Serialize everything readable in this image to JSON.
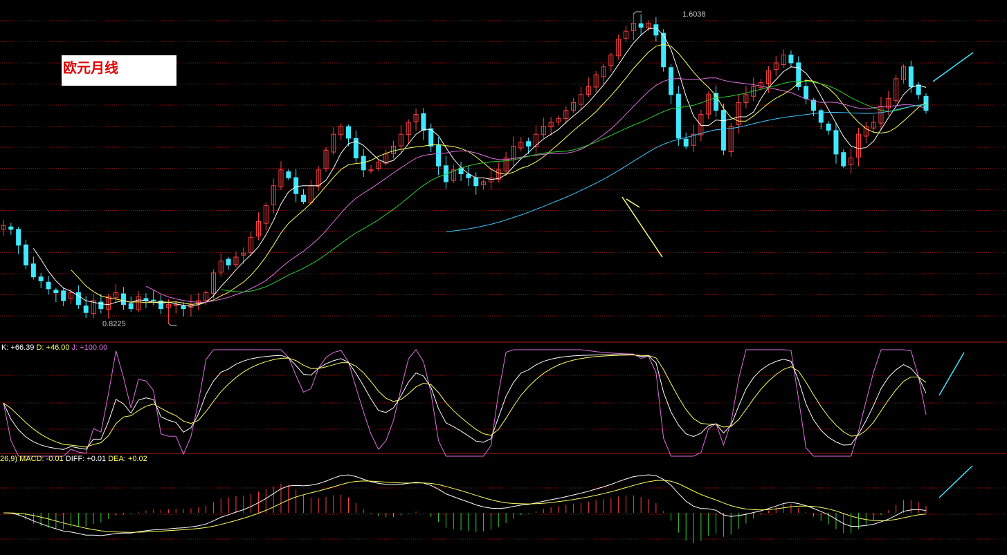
{
  "title": "欧元月线",
  "price_panel": {
    "high_label": "1.6038",
    "low_label": "0.8225"
  },
  "kdj_panel": {
    "k_label": "K: +66.39",
    "d_label": "D: +46.00",
    "j_label": "J: +100.00"
  },
  "macd_panel": {
    "params_label": "26,9)",
    "macd_label": "MACD: -0.01",
    "diff_label": "DIFF: +0.01",
    "dea_label": "DEA: +0.02"
  },
  "colors": {
    "background": "#000000",
    "grid": "#8a1a1a",
    "separator": "#b01c1c",
    "up": "#ff4040",
    "down": "#40e8ff",
    "ma5": "#ffffff",
    "ma10": "#ffff60",
    "ma20": "#e070e0",
    "ma30": "#30d030",
    "ma60": "#40c8ff",
    "k": "#ffffff",
    "d": "#ffff60",
    "j": "#e070e0",
    "macd_up": "#ff4040",
    "macd_down": "#30d030",
    "arrow": "#40e8ff",
    "note_line": "#ffff80"
  },
  "chart_data": [
    {
      "type": "candlestick",
      "period": "monthly",
      "high": 1.6038,
      "low": 0.8225,
      "series": [
        {
          "key": "close",
          "values": [
            1.07,
            1.06,
            1.02,
            0.97,
            0.94,
            0.93,
            0.91,
            0.9,
            0.88,
            0.9,
            0.87,
            0.85,
            0.88,
            0.86,
            0.89,
            0.9,
            0.87,
            0.86,
            0.89,
            0.88,
            0.88,
            0.86,
            0.87,
            0.87,
            0.86,
            0.87,
            0.88,
            0.9,
            0.95,
            0.98,
            0.97,
            0.99,
            1.0,
            1.04,
            1.08,
            1.12,
            1.17,
            1.21,
            1.19,
            1.15,
            1.13,
            1.17,
            1.21,
            1.26,
            1.3,
            1.32,
            1.29,
            1.24,
            1.21,
            1.21,
            1.23,
            1.25,
            1.27,
            1.3,
            1.33,
            1.35,
            1.31,
            1.27,
            1.22,
            1.18,
            1.21,
            1.2,
            1.19,
            1.17,
            1.18,
            1.19,
            1.21,
            1.24,
            1.27,
            1.28,
            1.27,
            1.3,
            1.32,
            1.33,
            1.34,
            1.36,
            1.38,
            1.4,
            1.42,
            1.45,
            1.47,
            1.5,
            1.54,
            1.56,
            1.58,
            1.57,
            1.58,
            1.55,
            1.47,
            1.4,
            1.29,
            1.27,
            1.3,
            1.35,
            1.4,
            1.36,
            1.26,
            1.32,
            1.38,
            1.4,
            1.42,
            1.43,
            1.46,
            1.48,
            1.5,
            1.48,
            1.42,
            1.39,
            1.36,
            1.33,
            1.31,
            1.25,
            1.22,
            1.24,
            1.3,
            1.32,
            1.33,
            1.37,
            1.39,
            1.44,
            1.47,
            1.42,
            1.4,
            1.36
          ]
        },
        {
          "key": "MA5",
          "color": "#ffffff"
        },
        {
          "key": "MA10",
          "color": "#ffff60"
        },
        {
          "key": "MA20",
          "color": "#e070e0"
        },
        {
          "key": "MA30",
          "color": "#30d030"
        },
        {
          "key": "MA60",
          "color": "#40c8ff"
        }
      ]
    },
    {
      "type": "line",
      "name": "KDJ",
      "series": [
        {
          "name": "K",
          "value": 66.39
        },
        {
          "name": "D",
          "value": 46.0
        },
        {
          "name": "J",
          "value": 100.0
        }
      ]
    },
    {
      "type": "bar",
      "name": "MACD",
      "series": [
        {
          "name": "MACD",
          "value": -0.01
        },
        {
          "name": "DIFF",
          "value": 0.01
        },
        {
          "name": "DEA",
          "value": 0.02
        }
      ]
    }
  ]
}
